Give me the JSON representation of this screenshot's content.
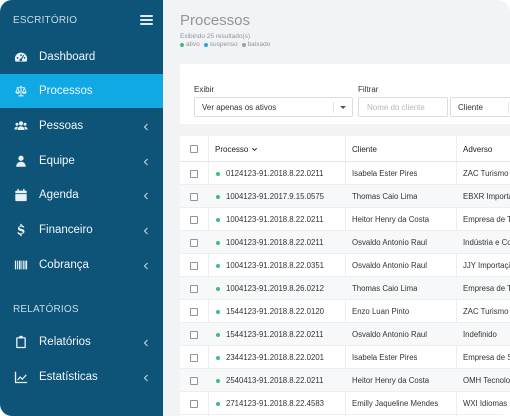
{
  "sidebar": {
    "section_office": "ESCRITÓRIO",
    "section_reports": "RELATÓRIOS",
    "items": [
      {
        "label": "Dashboard",
        "icon": "dashboard-icon",
        "chevron": false,
        "active": false
      },
      {
        "label": "Processos",
        "icon": "scale-icon",
        "chevron": false,
        "active": true
      },
      {
        "label": "Pessoas",
        "icon": "users-icon",
        "chevron": true,
        "active": false
      },
      {
        "label": "Equipe",
        "icon": "user-icon",
        "chevron": true,
        "active": false
      },
      {
        "label": "Agenda",
        "icon": "calendar-icon",
        "chevron": true,
        "active": false
      },
      {
        "label": "Financeiro",
        "icon": "dollar-icon",
        "chevron": true,
        "active": false
      },
      {
        "label": "Cobrança",
        "icon": "barcode-icon",
        "chevron": true,
        "active": false
      },
      {
        "label": "Relatórios",
        "icon": "clipboard-icon",
        "chevron": true,
        "active": false
      },
      {
        "label": "Estatísticas",
        "icon": "chart-icon",
        "chevron": true,
        "active": false
      }
    ]
  },
  "header": {
    "title": "Processos",
    "subtitle": "Exibindo 25 resultado(s)",
    "legend": [
      {
        "label": "ativo",
        "color": "#3bbf7a"
      },
      {
        "label": "suspenso",
        "color": "#29a3e0"
      },
      {
        "label": "baixado",
        "color": "#9aa1a7"
      }
    ]
  },
  "filters": {
    "exibir_label": "Exibir",
    "exibir_value": "Ver apenas os ativos",
    "filtrar_label": "Filtrar",
    "cliente_placeholder": "Nome do cliente",
    "type_value": "Cliente"
  },
  "table": {
    "columns": [
      "Processo",
      "Cliente",
      "Adverso"
    ],
    "rows": [
      {
        "processo": "0124123-91.2018.8.22.0211",
        "cliente": "Isabela Ester Pires",
        "adverso": "ZAC Turismo"
      },
      {
        "processo": "1004123-91.2017.9.15.0575",
        "cliente": "Thomas Caio Lima",
        "adverso": "EBXR Importaç"
      },
      {
        "processo": "1004123-91.2018.8.22.0211",
        "cliente": "Heitor Henry da Costa",
        "adverso": "Empresa de T"
      },
      {
        "processo": "1004123-91.2018.8.22.0211",
        "cliente": "Osvaldo Antonio Raul",
        "adverso": "Indústria e Co"
      },
      {
        "processo": "1004123-91.2018.8.22.0351",
        "cliente": "Osvaldo Antonio Raul",
        "adverso": "JJY Importaçã"
      },
      {
        "processo": "1004123-91.2019.8.26.0212",
        "cliente": "Thomas Caio Lima",
        "adverso": "Empresa de T"
      },
      {
        "processo": "1544123-91.2018.8.22.0120",
        "cliente": "Enzo Luan Pinto",
        "adverso": "ZAC Turismo"
      },
      {
        "processo": "1544123-91.2018.8.22.0211",
        "cliente": "Osvaldo Antonio Raul",
        "adverso": "Indefinido"
      },
      {
        "processo": "2344123-91.2018.8.22.0201",
        "cliente": "Isabela Ester Pires",
        "adverso": "Empresa de S"
      },
      {
        "processo": "2540413-91.2018.8.22.0211",
        "cliente": "Heitor Henry da Costa",
        "adverso": "OMH Tecnolo"
      },
      {
        "processo": "2714123-91.2018.8.22.4583",
        "cliente": "Emilly Jaqueline Mendes",
        "adverso": "WXI Idiomas I"
      }
    ]
  },
  "colors": {
    "sidebar_bg": "#0d5478",
    "active_bg": "#11a9e3",
    "status_active": "#3bbf7a"
  }
}
